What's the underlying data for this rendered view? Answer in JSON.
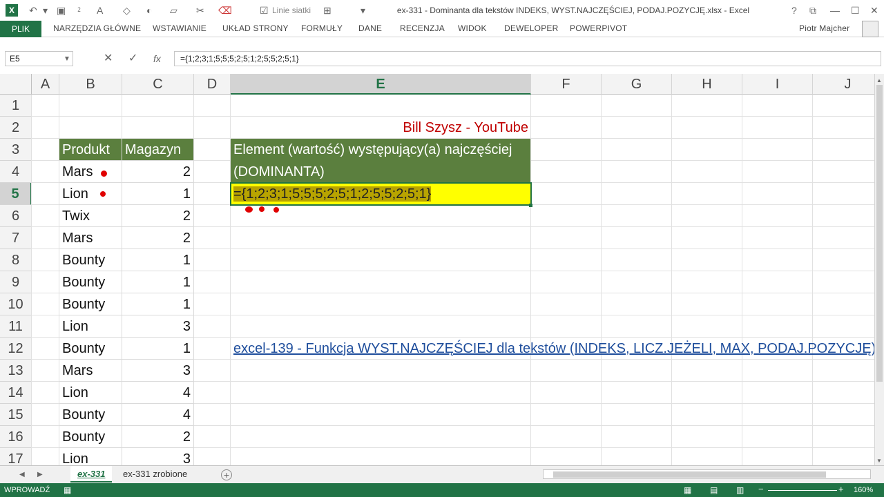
{
  "window": {
    "title": "ex-331 - Dominanta dla tekstów INDEKS, WYST.NAJCZĘŚCIEJ, PODAJ.POZYCJĘ.xlsx - Excel",
    "toolbar_gridlines_label": "Linie siatki",
    "user": "Piotr Majcher"
  },
  "ribbon": {
    "tabs": [
      "PLIK",
      "NARZĘDZIA GŁÓWNE",
      "WSTAWIANIE",
      "UKŁAD STRONY",
      "FORMUŁY",
      "DANE",
      "RECENZJA",
      "WIDOK",
      "DEWELOPER",
      "POWERPIVOT"
    ]
  },
  "formula_bar": {
    "name_box": "E5",
    "formula": "={1;2;3;1;5;5;5;2;5;1;2;5;5;2;5;1}"
  },
  "columns": [
    "A",
    "B",
    "C",
    "D",
    "E",
    "F",
    "G",
    "H",
    "I",
    "J"
  ],
  "rows": [
    "1",
    "2",
    "3",
    "4",
    "5",
    "6",
    "7",
    "8",
    "9",
    "10",
    "11",
    "12",
    "13",
    "14",
    "15",
    "16",
    "17"
  ],
  "cells": {
    "E2": "Bill Szysz - YouTube",
    "B3": "Produkt",
    "C3": "Magazyn",
    "E3": "Element (wartość) występujący(a) najczęściej",
    "E4": "(DOMINANTA)",
    "E5": "={1;2;3;1;5;5;5;2;5;1;2;5;5;2;5;1}",
    "E12": "excel-139 - Funkcja WYST.NAJCZĘŚCIEJ dla tekstów (INDEKS, LICZ.JEŻELI, MAX, PODAJ.POZYCJĘ)"
  },
  "table": [
    {
      "product": "Mars",
      "qty": "2"
    },
    {
      "product": "Lion",
      "qty": "1"
    },
    {
      "product": "Twix",
      "qty": "2"
    },
    {
      "product": "Mars",
      "qty": "2"
    },
    {
      "product": "Bounty",
      "qty": "1"
    },
    {
      "product": "Bounty",
      "qty": "1"
    },
    {
      "product": "Bounty",
      "qty": "1"
    },
    {
      "product": "Lion",
      "qty": "3"
    },
    {
      "product": "Bounty",
      "qty": "1"
    },
    {
      "product": "Mars",
      "qty": "3"
    },
    {
      "product": "Lion",
      "qty": "4"
    },
    {
      "product": "Bounty",
      "qty": "4"
    },
    {
      "product": "Bounty",
      "qty": "2"
    },
    {
      "product": "Lion",
      "qty": "3"
    }
  ],
  "sheets": {
    "active": "ex-331",
    "other": "ex-331 zrobione"
  },
  "status": {
    "mode": "WPROWADŹ",
    "zoom": "160%"
  },
  "colors": {
    "excel_green": "#217346",
    "header_fill": "#5b7f3e",
    "highlight_yellow": "#ffff00",
    "link_blue": "#1f4e9c",
    "red_text": "#c00000"
  }
}
